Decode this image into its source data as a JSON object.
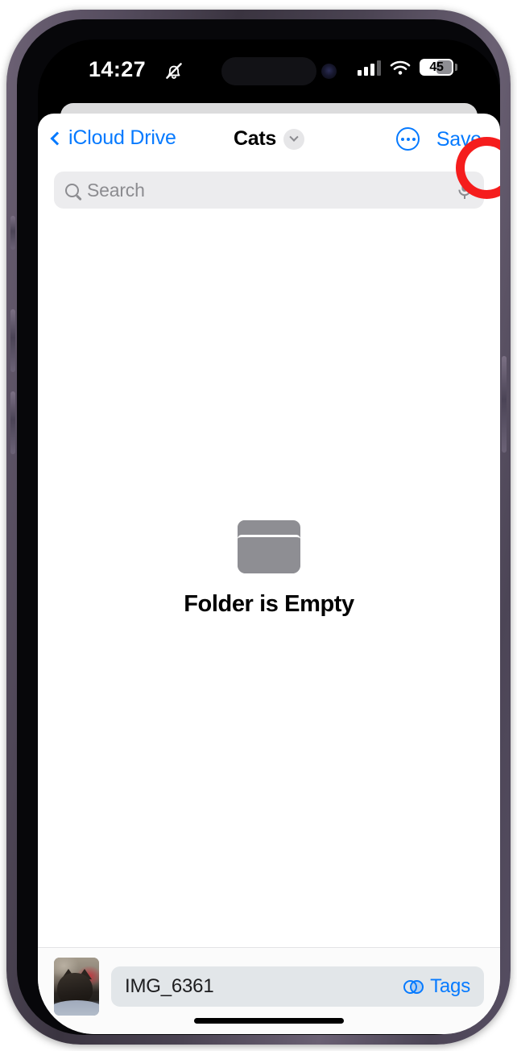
{
  "status_bar": {
    "time": "14:27",
    "silent_icon": "bell-slash-icon",
    "signal_icon": "cellular-bars-icon",
    "wifi_icon": "wifi-icon",
    "battery_level": "45"
  },
  "nav": {
    "back_label": "iCloud Drive",
    "back_icon": "chevron-left-icon",
    "title": "Cats",
    "title_chevron_icon": "chevron-down-icon",
    "more_icon": "ellipsis-circle-icon",
    "save_label": "Save"
  },
  "search": {
    "placeholder": "Search",
    "search_icon": "search-icon",
    "mic_icon": "microphone-icon"
  },
  "empty_state": {
    "folder_icon": "folder-icon",
    "label": "Folder is Empty"
  },
  "bottom_bar": {
    "thumbnail_name": "photo-thumbnail",
    "filename": "IMG_6361",
    "tags_label": "Tags",
    "tags_icon": "tags-circles-icon"
  },
  "annotation": {
    "type": "circle-highlight",
    "target": "Save",
    "color": "#f51d1d"
  },
  "colors": {
    "accent_blue": "#067aff",
    "annotation_red": "#f51d1d",
    "folder_gray": "#8e8e93",
    "search_bg": "#ececee",
    "file_field_bg": "#e2e6e9"
  }
}
